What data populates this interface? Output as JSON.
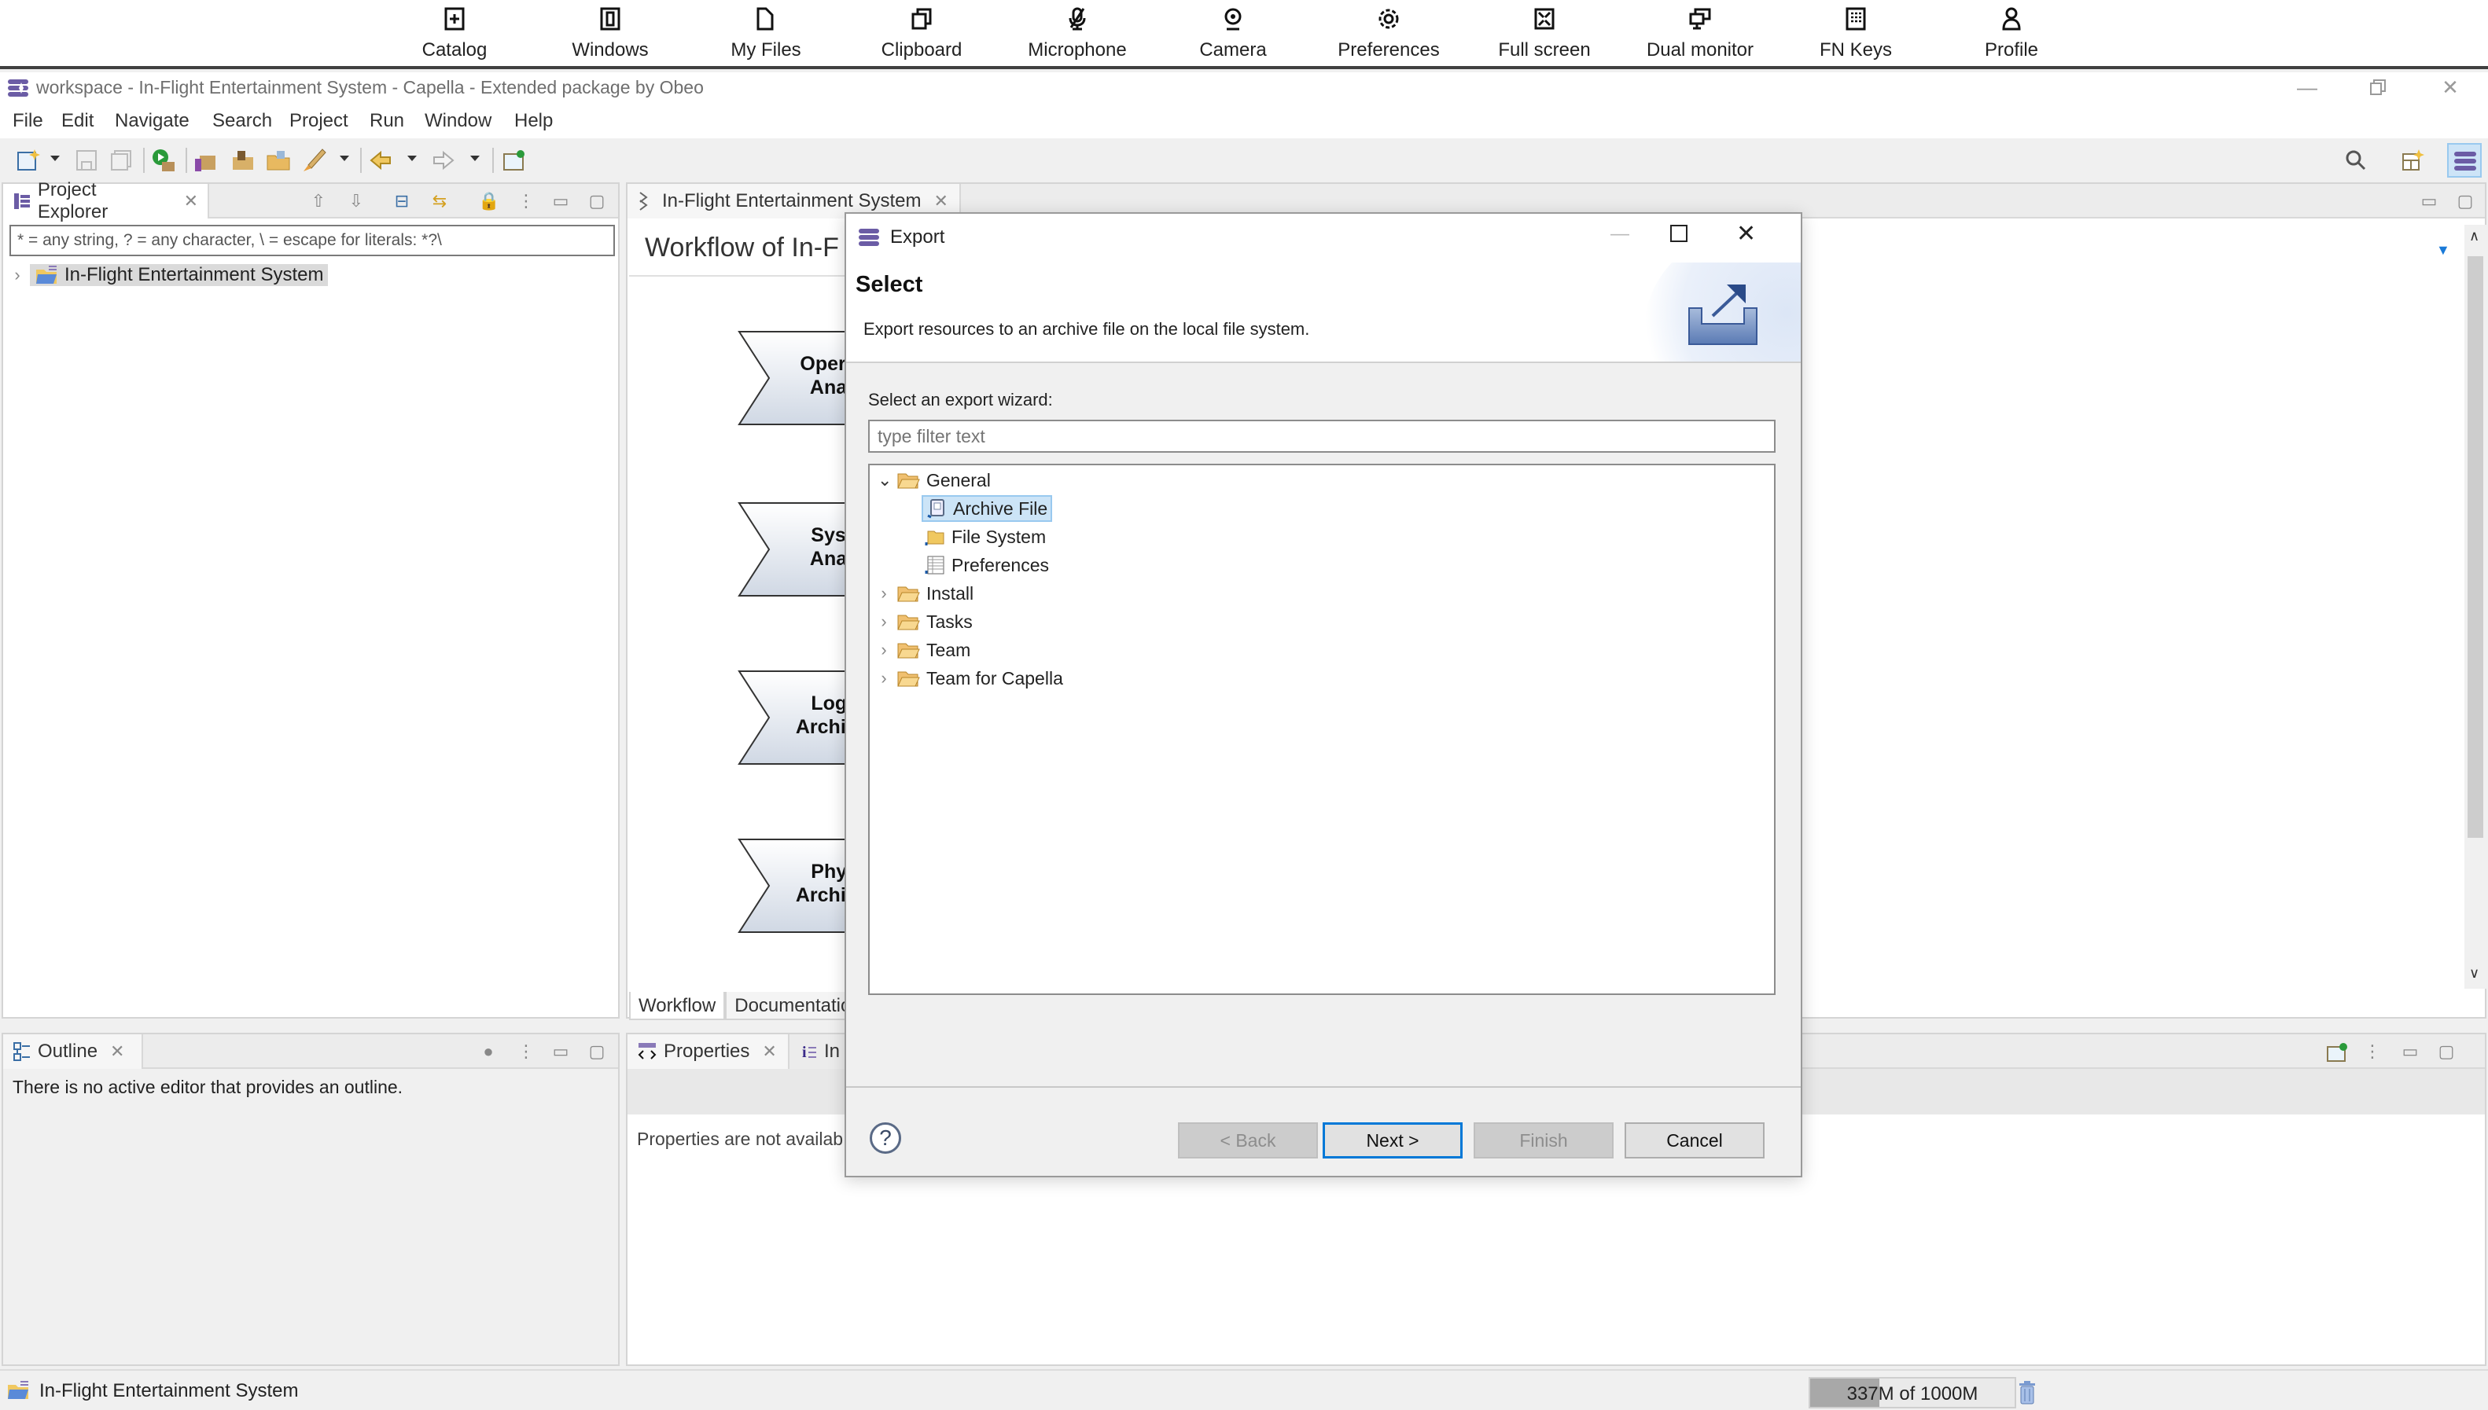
{
  "remote_toolbar": {
    "items": [
      {
        "label": "Catalog",
        "icon": "catalog-icon"
      },
      {
        "label": "Windows",
        "icon": "windows-icon"
      },
      {
        "label": "My Files",
        "icon": "file-icon"
      },
      {
        "label": "Clipboard",
        "icon": "clipboard-icon"
      },
      {
        "label": "Microphone",
        "icon": "microphone-muted-icon"
      },
      {
        "label": "Camera",
        "icon": "camera-icon"
      },
      {
        "label": "Preferences",
        "icon": "gear-icon"
      },
      {
        "label": "Full screen",
        "icon": "fullscreen-icon"
      },
      {
        "label": "Dual monitor",
        "icon": "dual-monitor-icon"
      },
      {
        "label": "FN Keys",
        "icon": "keyboard-icon"
      },
      {
        "label": "Profile",
        "icon": "user-icon"
      }
    ]
  },
  "window": {
    "title": "workspace - In-Flight Entertainment System - Capella - Extended package by Obeo"
  },
  "menu": {
    "items": [
      "File",
      "Edit",
      "Navigate",
      "Search",
      "Project",
      "Run",
      "Window",
      "Help"
    ]
  },
  "project_explorer": {
    "tab_label": "Project Explorer",
    "filter_text": "* = any string, ? = any character, \\ = escape for literals: *?\\",
    "tree": [
      {
        "label": "In-Flight Entertainment System",
        "expanded": false,
        "selected": true
      }
    ]
  },
  "editor": {
    "tab_label": "In-Flight Entertainment System",
    "workflow_title": "Workflow of In-F",
    "workflow_steps": [
      {
        "label": "Operat\nAnaly"
      },
      {
        "label": "Syste\nAnaly"
      },
      {
        "label": "Logic\nArchite"
      },
      {
        "label": "Physi\nArchite"
      }
    ],
    "bottom_tabs": [
      "Workflow",
      "Documentatio"
    ]
  },
  "outline": {
    "tab_label": "Outline",
    "message": "There is no active editor that provides an outline."
  },
  "properties": {
    "tab_label": "Properties",
    "second_tab_label": "In",
    "message": "Properties are not availab"
  },
  "export_dialog": {
    "title": "Export",
    "heading": "Select",
    "description": "Export resources to an archive file on the local file system.",
    "wizard_label": "Select an export wizard:",
    "filter_placeholder": "type filter text",
    "tree": [
      {
        "label": "General",
        "level": 0,
        "expanded": true
      },
      {
        "label": "Archive File",
        "level": 1,
        "selected": true
      },
      {
        "label": "File System",
        "level": 1
      },
      {
        "label": "Preferences",
        "level": 1
      },
      {
        "label": "Install",
        "level": 0,
        "expanded": false
      },
      {
        "label": "Tasks",
        "level": 0,
        "expanded": false
      },
      {
        "label": "Team",
        "level": 0,
        "expanded": false
      },
      {
        "label": "Team for Capella",
        "level": 0,
        "expanded": false
      }
    ],
    "buttons": {
      "back": "< Back",
      "next": "Next >",
      "finish": "Finish",
      "cancel": "Cancel"
    },
    "help_label": "?"
  },
  "status_bar": {
    "selection": "In-Flight Entertainment System",
    "heap_text": "337M of 1000M",
    "heap_used_fraction": 0.337
  },
  "colors": {
    "accent": "#0078d7",
    "selection": "#cce4f7",
    "folder": "#e8b960"
  }
}
